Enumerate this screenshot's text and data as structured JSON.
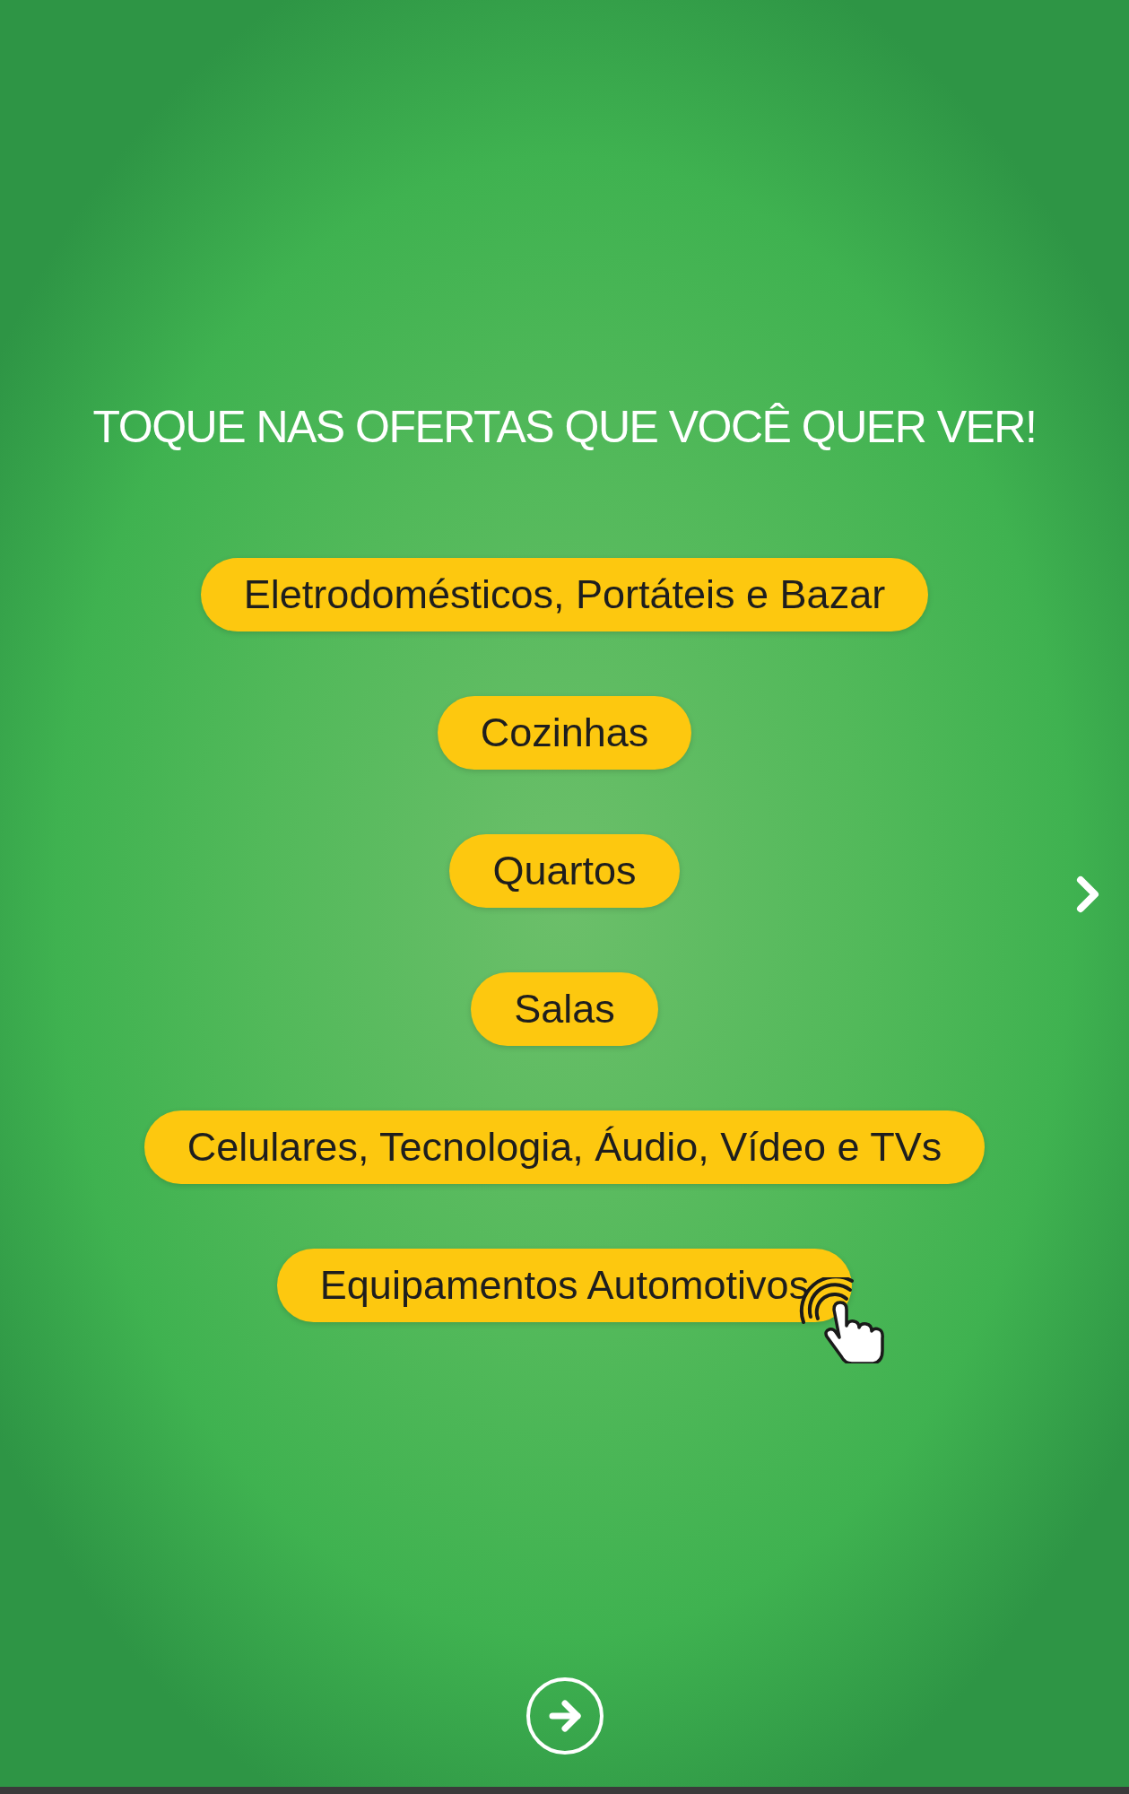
{
  "title": "TOQUE NAS OFERTAS QUE VOCÊ QUER VER!",
  "categories": [
    {
      "label": "Eletrodomésticos, Portáteis e Bazar"
    },
    {
      "label": "Cozinhas"
    },
    {
      "label": "Quartos"
    },
    {
      "label": "Salas"
    },
    {
      "label": "Celulares, Tecnologia, Áudio, Vídeo e TVs"
    },
    {
      "label": "Equipamentos Automotivos"
    }
  ]
}
